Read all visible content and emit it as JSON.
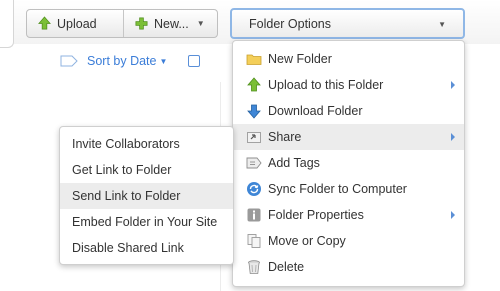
{
  "toolbar": {
    "upload_label": "Upload",
    "new_label": "New...",
    "folder_options_label": "Folder Options"
  },
  "sort": {
    "label": "Sort by Date"
  },
  "menu": {
    "items": [
      {
        "label": "New Folder",
        "icon": "folder-icon",
        "submenu": false
      },
      {
        "label": "Upload to this Folder",
        "icon": "upload-arrow-icon",
        "submenu": true
      },
      {
        "label": "Download Folder",
        "icon": "download-arrow-icon",
        "submenu": false
      },
      {
        "label": "Share",
        "icon": "share-icon",
        "submenu": true,
        "highlighted": true
      },
      {
        "label": "Add Tags",
        "icon": "tag-icon",
        "submenu": false
      },
      {
        "label": "Sync Folder to Computer",
        "icon": "sync-icon",
        "submenu": false
      },
      {
        "label": "Folder Properties",
        "icon": "info-icon",
        "submenu": true
      },
      {
        "label": "Move or Copy",
        "icon": "copy-icon",
        "submenu": false
      },
      {
        "label": "Delete",
        "icon": "trash-icon",
        "submenu": false
      }
    ]
  },
  "submenu": {
    "items": [
      {
        "label": "Invite Collaborators"
      },
      {
        "label": "Get Link to Folder"
      },
      {
        "label": "Send Link to Folder",
        "highlighted": true
      },
      {
        "label": "Embed Folder in Your Site"
      },
      {
        "label": "Disable Shared Link"
      }
    ]
  },
  "colors": {
    "accent": "#3b7dd8",
    "focus_border": "#8fb7e6",
    "highlight": "#ececec",
    "upload_green": "#6fb52c"
  }
}
